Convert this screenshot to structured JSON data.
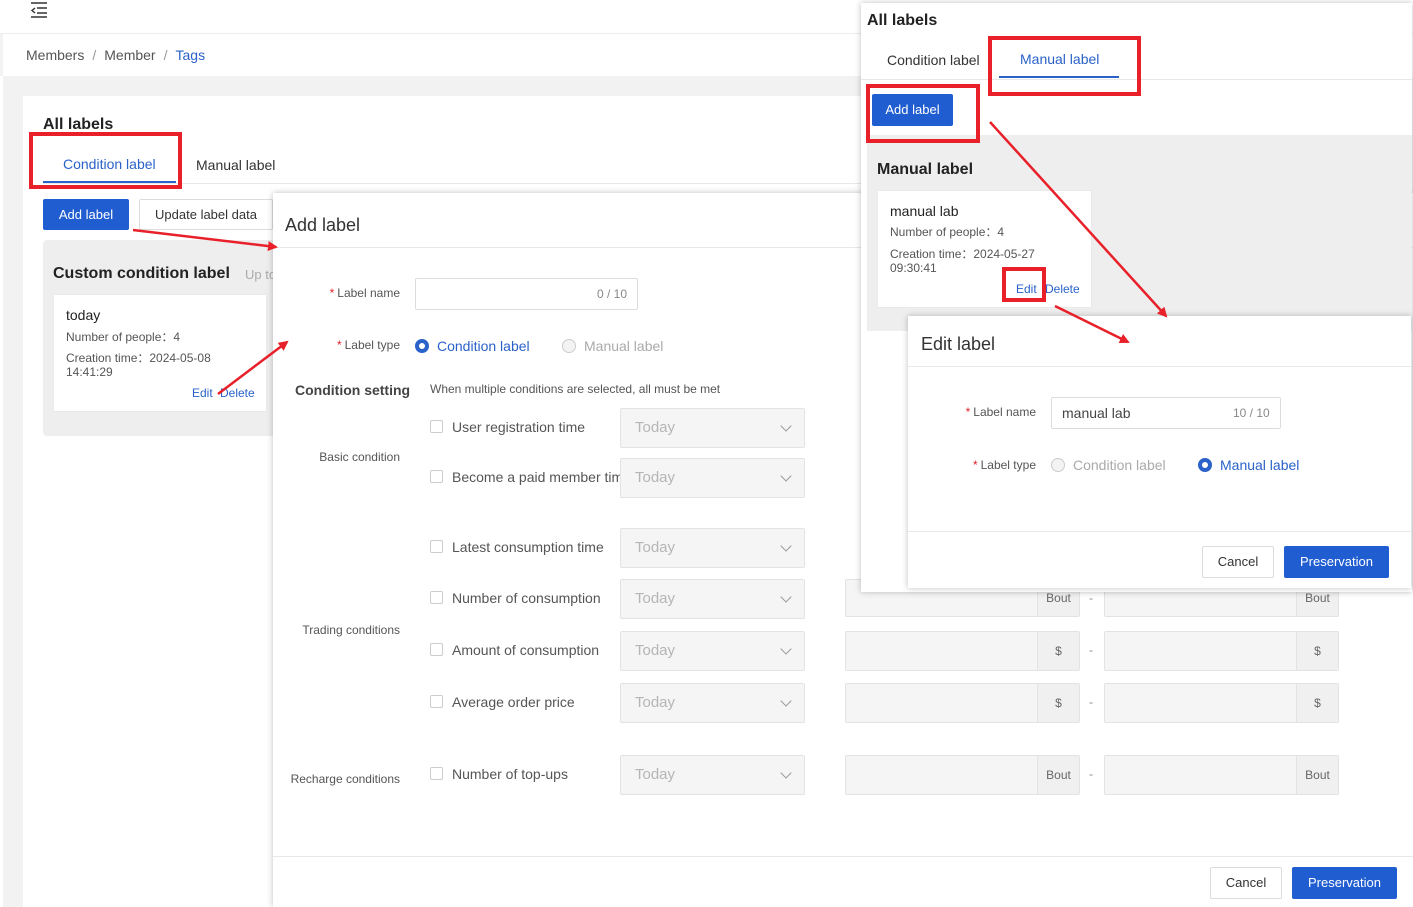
{
  "breadcrumb": {
    "items": [
      "Members",
      "Member"
    ],
    "current": "Tags",
    "separator": "/"
  },
  "main": {
    "title": "All labels",
    "tabs": [
      {
        "label": "Condition label",
        "active": true
      },
      {
        "label": "Manual label",
        "active": false
      }
    ],
    "add_label": "Add label",
    "update_label_data": "Update label data",
    "panel_title": "Custom condition label",
    "panel_subtitle": "Up to",
    "card": {
      "name": "today",
      "people": "Number of people：4",
      "created": "Creation time：2024-05-08 14:41:29",
      "edit": "Edit",
      "delete": "Delete"
    }
  },
  "add_modal": {
    "title": "Add label",
    "label_name_label": "Label name",
    "label_name_counter": "0 / 10",
    "label_type_label": "Label type",
    "type_options": [
      {
        "label": "Condition label",
        "selected": true
      },
      {
        "label": "Manual label",
        "selected": false
      }
    ],
    "condition_setting": "Condition setting",
    "condition_hint": "When multiple conditions are selected, all must be met",
    "groups": {
      "basic": "Basic condition",
      "trading": "Trading conditions",
      "recharge": "Recharge conditions"
    },
    "conditions": [
      {
        "label": "User registration time",
        "select": "Today"
      },
      {
        "label": "Become a paid member time",
        "select": "Today"
      },
      {
        "label": "Latest consumption time",
        "select": "Today"
      },
      {
        "label": "Number of consumption",
        "select": "Today",
        "unit": "Bout"
      },
      {
        "label": "Amount of consumption",
        "select": "Today",
        "unit": "$"
      },
      {
        "label": "Average order price",
        "select": "Today",
        "unit": "$"
      },
      {
        "label": "Number of top-ups",
        "select": "Today",
        "unit": "Bout"
      }
    ],
    "range_dash": "-",
    "cancel": "Cancel",
    "save": "Preservation"
  },
  "right_panel": {
    "title": "All labels",
    "tabs": [
      {
        "label": "Condition label",
        "active": false
      },
      {
        "label": "Manual label",
        "active": true
      }
    ],
    "add_label": "Add label",
    "section_title": "Manual label",
    "card": {
      "name": "manual lab",
      "people": "Number of people：4",
      "created": "Creation time：2024-05-27 09:30:41",
      "edit": "Edit",
      "delete": "Delete"
    }
  },
  "edit_modal": {
    "title": "Edit label",
    "label_name_label": "Label name",
    "label_name_value": "manual lab",
    "label_name_counter": "10 / 10",
    "label_type_label": "Label type",
    "type_options": [
      {
        "label": "Condition label",
        "selected": false
      },
      {
        "label": "Manual label",
        "selected": true
      }
    ],
    "cancel": "Cancel",
    "save": "Preservation"
  },
  "colors": {
    "primary": "#1f5dd1",
    "link": "#2a62c9",
    "annotation_red": "#e8202a"
  },
  "icons": {
    "menu": "menu-collapse-icon",
    "chevron": "chevron-down-icon"
  }
}
